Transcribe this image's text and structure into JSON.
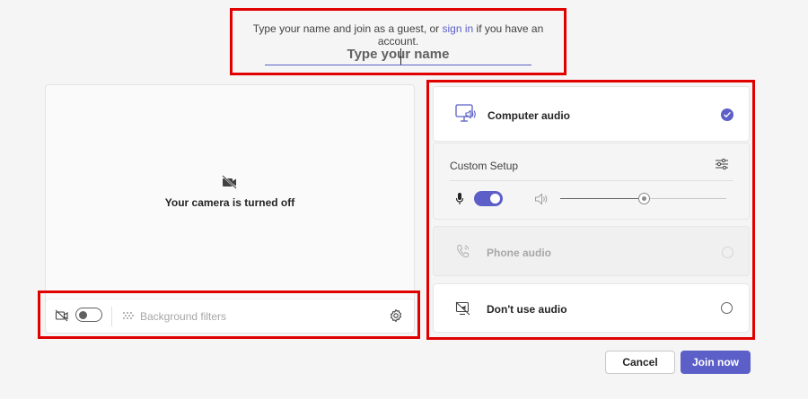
{
  "name_prompt": {
    "text_before": "Type your name and join as a guest, or ",
    "sign_in_link": "sign in",
    "text_after": " if you have an account.",
    "name_placeholder": "Type your name",
    "name_value": ""
  },
  "camera": {
    "status_text": "Your camera is turned off",
    "camera_toggle_on": false,
    "background_filters_label": "Background filters"
  },
  "audio": {
    "computer_audio": {
      "label": "Computer audio",
      "selected": true
    },
    "custom_setup": {
      "label": "Custom Setup",
      "mic_on": true,
      "speaker_volume": 0.5
    },
    "phone_audio": {
      "label": "Phone audio",
      "selected": false,
      "disabled": true
    },
    "dont_use_audio": {
      "label": "Don't use audio",
      "selected": false
    }
  },
  "actions": {
    "cancel_label": "Cancel",
    "join_label": "Join now"
  },
  "colors": {
    "accent": "#5b5fc7",
    "highlight_outline": "#e00000"
  }
}
